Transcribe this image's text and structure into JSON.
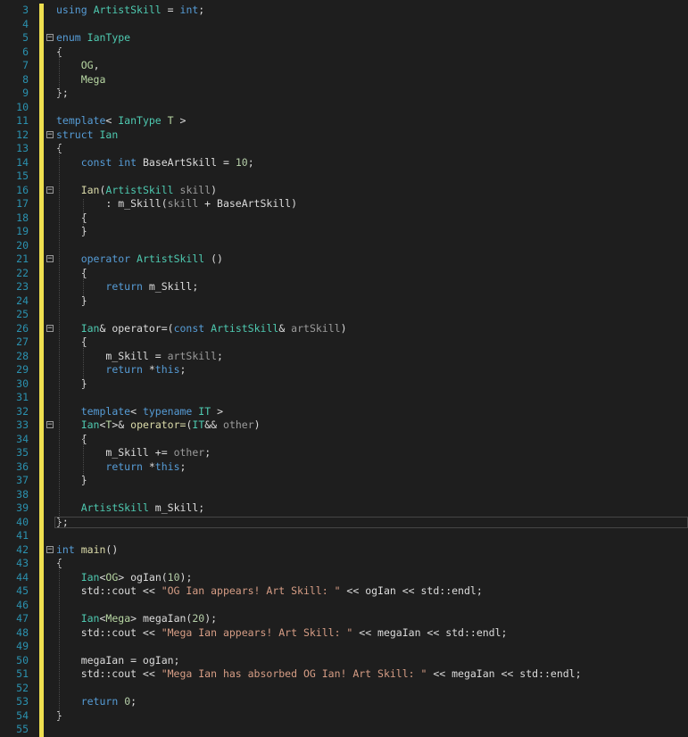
{
  "editor": {
    "colors": {
      "background": "#1e1e1e",
      "line_number": "#2b91af",
      "change_marker": "#eedf4f",
      "keyword": "#569cd6",
      "type": "#4ec9b0",
      "function": "#dcdcaa",
      "string": "#d69d85",
      "number": "#b5cea8",
      "parameter": "#9b9b9b"
    },
    "lines": [
      {
        "n": "3",
        "fold": false,
        "tokens": [
          {
            "t": "using",
            "c": "kw"
          },
          {
            "t": " ",
            "c": "pl"
          },
          {
            "t": "ArtistSkill",
            "c": "ty"
          },
          {
            "t": " = ",
            "c": "pl"
          },
          {
            "t": "int",
            "c": "kw"
          },
          {
            "t": ";",
            "c": "pl"
          }
        ]
      },
      {
        "n": "4",
        "fold": false,
        "tokens": []
      },
      {
        "n": "5",
        "fold": true,
        "tokens": [
          {
            "t": "enum",
            "c": "kw"
          },
          {
            "t": " ",
            "c": "pl"
          },
          {
            "t": "IanType",
            "c": "ty"
          }
        ]
      },
      {
        "n": "6",
        "fold": false,
        "tokens": [
          {
            "t": "{",
            "c": "pl"
          }
        ]
      },
      {
        "n": "7",
        "fold": false,
        "tokens": [
          {
            "t": "    ",
            "c": "pl"
          },
          {
            "t": "OG",
            "c": "en"
          },
          {
            "t": ",",
            "c": "pl"
          }
        ]
      },
      {
        "n": "8",
        "fold": false,
        "tokens": [
          {
            "t": "    ",
            "c": "pl"
          },
          {
            "t": "Mega",
            "c": "en"
          }
        ]
      },
      {
        "n": "9",
        "fold": false,
        "tokens": [
          {
            "t": "};",
            "c": "pl"
          }
        ]
      },
      {
        "n": "10",
        "fold": false,
        "tokens": []
      },
      {
        "n": "11",
        "fold": false,
        "tokens": [
          {
            "t": "template",
            "c": "kw"
          },
          {
            "t": "< ",
            "c": "pl"
          },
          {
            "t": "IanType",
            "c": "ty"
          },
          {
            "t": " ",
            "c": "pl"
          },
          {
            "t": "T",
            "c": "tp"
          },
          {
            "t": " >",
            "c": "pl"
          }
        ]
      },
      {
        "n": "12",
        "fold": true,
        "tokens": [
          {
            "t": "struct",
            "c": "kw"
          },
          {
            "t": " ",
            "c": "pl"
          },
          {
            "t": "Ian",
            "c": "ty"
          }
        ]
      },
      {
        "n": "13",
        "fold": false,
        "tokens": [
          {
            "t": "{",
            "c": "pl"
          }
        ]
      },
      {
        "n": "14",
        "fold": false,
        "tokens": [
          {
            "t": "    ",
            "c": "pl"
          },
          {
            "t": "const",
            "c": "kw"
          },
          {
            "t": " ",
            "c": "pl"
          },
          {
            "t": "int",
            "c": "kw"
          },
          {
            "t": " BaseArtSkill = ",
            "c": "pl"
          },
          {
            "t": "10",
            "c": "nu"
          },
          {
            "t": ";",
            "c": "pl"
          }
        ]
      },
      {
        "n": "15",
        "fold": false,
        "tokens": []
      },
      {
        "n": "16",
        "fold": true,
        "tokens": [
          {
            "t": "    ",
            "c": "pl"
          },
          {
            "t": "Ian",
            "c": "fn"
          },
          {
            "t": "(",
            "c": "pl"
          },
          {
            "t": "ArtistSkill",
            "c": "ty"
          },
          {
            "t": " ",
            "c": "pl"
          },
          {
            "t": "skill",
            "c": "pa"
          },
          {
            "t": ")",
            "c": "pl"
          }
        ]
      },
      {
        "n": "17",
        "fold": false,
        "tokens": [
          {
            "t": "        : m_Skill(",
            "c": "pl"
          },
          {
            "t": "skill",
            "c": "pa"
          },
          {
            "t": " + BaseArtSkill)",
            "c": "pl"
          }
        ]
      },
      {
        "n": "18",
        "fold": false,
        "tokens": [
          {
            "t": "    {",
            "c": "pl"
          }
        ]
      },
      {
        "n": "19",
        "fold": false,
        "tokens": [
          {
            "t": "    }",
            "c": "pl"
          }
        ]
      },
      {
        "n": "20",
        "fold": false,
        "tokens": []
      },
      {
        "n": "21",
        "fold": true,
        "tokens": [
          {
            "t": "    ",
            "c": "pl"
          },
          {
            "t": "operator",
            "c": "kw"
          },
          {
            "t": " ",
            "c": "pl"
          },
          {
            "t": "ArtistSkill",
            "c": "ty"
          },
          {
            "t": " ()",
            "c": "pl"
          }
        ]
      },
      {
        "n": "22",
        "fold": false,
        "tokens": [
          {
            "t": "    {",
            "c": "pl"
          }
        ]
      },
      {
        "n": "23",
        "fold": false,
        "tokens": [
          {
            "t": "        ",
            "c": "pl"
          },
          {
            "t": "return",
            "c": "kw"
          },
          {
            "t": " m_Skill;",
            "c": "pl"
          }
        ]
      },
      {
        "n": "24",
        "fold": false,
        "tokens": [
          {
            "t": "    }",
            "c": "pl"
          }
        ]
      },
      {
        "n": "25",
        "fold": false,
        "tokens": []
      },
      {
        "n": "26",
        "fold": true,
        "tokens": [
          {
            "t": "    ",
            "c": "pl"
          },
          {
            "t": "Ian",
            "c": "ty"
          },
          {
            "t": "& operator=(",
            "c": "pl"
          },
          {
            "t": "const",
            "c": "kw"
          },
          {
            "t": " ",
            "c": "pl"
          },
          {
            "t": "ArtistSkill",
            "c": "ty"
          },
          {
            "t": "& ",
            "c": "pl"
          },
          {
            "t": "artSkill",
            "c": "pa"
          },
          {
            "t": ")",
            "c": "pl"
          }
        ]
      },
      {
        "n": "27",
        "fold": false,
        "tokens": [
          {
            "t": "    {",
            "c": "pl"
          }
        ]
      },
      {
        "n": "28",
        "fold": false,
        "tokens": [
          {
            "t": "        m_Skill = ",
            "c": "pl"
          },
          {
            "t": "artSkill",
            "c": "pa"
          },
          {
            "t": ";",
            "c": "pl"
          }
        ]
      },
      {
        "n": "29",
        "fold": false,
        "tokens": [
          {
            "t": "        ",
            "c": "pl"
          },
          {
            "t": "return",
            "c": "kw"
          },
          {
            "t": " *",
            "c": "pl"
          },
          {
            "t": "this",
            "c": "kw"
          },
          {
            "t": ";",
            "c": "pl"
          }
        ]
      },
      {
        "n": "30",
        "fold": false,
        "tokens": [
          {
            "t": "    }",
            "c": "pl"
          }
        ]
      },
      {
        "n": "31",
        "fold": false,
        "tokens": []
      },
      {
        "n": "32",
        "fold": false,
        "tokens": [
          {
            "t": "    ",
            "c": "pl"
          },
          {
            "t": "template",
            "c": "kw"
          },
          {
            "t": "< ",
            "c": "pl"
          },
          {
            "t": "typename",
            "c": "kw"
          },
          {
            "t": " ",
            "c": "pl"
          },
          {
            "t": "IT",
            "c": "ty"
          },
          {
            "t": " >",
            "c": "pl"
          }
        ]
      },
      {
        "n": "33",
        "fold": true,
        "tokens": [
          {
            "t": "    ",
            "c": "pl"
          },
          {
            "t": "Ian",
            "c": "ty"
          },
          {
            "t": "<",
            "c": "pl"
          },
          {
            "t": "T",
            "c": "tp"
          },
          {
            "t": ">& ",
            "c": "pl"
          },
          {
            "t": "operator=",
            "c": "fn"
          },
          {
            "t": "(",
            "c": "pl"
          },
          {
            "t": "IT",
            "c": "ty"
          },
          {
            "t": "&& ",
            "c": "pl"
          },
          {
            "t": "other",
            "c": "pa"
          },
          {
            "t": ")",
            "c": "pl"
          }
        ]
      },
      {
        "n": "34",
        "fold": false,
        "tokens": [
          {
            "t": "    {",
            "c": "pl"
          }
        ]
      },
      {
        "n": "35",
        "fold": false,
        "tokens": [
          {
            "t": "        m_Skill += ",
            "c": "pl"
          },
          {
            "t": "other",
            "c": "pa"
          },
          {
            "t": ";",
            "c": "pl"
          }
        ]
      },
      {
        "n": "36",
        "fold": false,
        "tokens": [
          {
            "t": "        ",
            "c": "pl"
          },
          {
            "t": "return",
            "c": "kw"
          },
          {
            "t": " *",
            "c": "pl"
          },
          {
            "t": "this",
            "c": "kw"
          },
          {
            "t": ";",
            "c": "pl"
          }
        ]
      },
      {
        "n": "37",
        "fold": false,
        "tokens": [
          {
            "t": "    }",
            "c": "pl"
          }
        ]
      },
      {
        "n": "38",
        "fold": false,
        "tokens": []
      },
      {
        "n": "39",
        "fold": false,
        "tokens": [
          {
            "t": "    ",
            "c": "pl"
          },
          {
            "t": "ArtistSkill",
            "c": "ty"
          },
          {
            "t": " m_Skill;",
            "c": "pl"
          }
        ]
      },
      {
        "n": "40",
        "fold": false,
        "current": true,
        "tokens": [
          {
            "t": "};",
            "c": "pl"
          }
        ]
      },
      {
        "n": "41",
        "fold": false,
        "tokens": []
      },
      {
        "n": "42",
        "fold": true,
        "tokens": [
          {
            "t": "int",
            "c": "kw"
          },
          {
            "t": " ",
            "c": "pl"
          },
          {
            "t": "main",
            "c": "fn"
          },
          {
            "t": "()",
            "c": "pl"
          }
        ]
      },
      {
        "n": "43",
        "fold": false,
        "tokens": [
          {
            "t": "{",
            "c": "pl"
          }
        ]
      },
      {
        "n": "44",
        "fold": false,
        "tokens": [
          {
            "t": "    ",
            "c": "pl"
          },
          {
            "t": "Ian",
            "c": "ty"
          },
          {
            "t": "<",
            "c": "pl"
          },
          {
            "t": "OG",
            "c": "en"
          },
          {
            "t": "> ogIan(",
            "c": "pl"
          },
          {
            "t": "10",
            "c": "nu"
          },
          {
            "t": ");",
            "c": "pl"
          }
        ]
      },
      {
        "n": "45",
        "fold": false,
        "tokens": [
          {
            "t": "    std::cout << ",
            "c": "pl"
          },
          {
            "t": "\"OG Ian appears! Art Skill: \"",
            "c": "st"
          },
          {
            "t": " << ogIan << std::endl;",
            "c": "pl"
          }
        ]
      },
      {
        "n": "46",
        "fold": false,
        "tokens": []
      },
      {
        "n": "47",
        "fold": false,
        "tokens": [
          {
            "t": "    ",
            "c": "pl"
          },
          {
            "t": "Ian",
            "c": "ty"
          },
          {
            "t": "<",
            "c": "pl"
          },
          {
            "t": "Mega",
            "c": "en"
          },
          {
            "t": "> megaIan(",
            "c": "pl"
          },
          {
            "t": "20",
            "c": "nu"
          },
          {
            "t": ");",
            "c": "pl"
          }
        ]
      },
      {
        "n": "48",
        "fold": false,
        "tokens": [
          {
            "t": "    std::cout << ",
            "c": "pl"
          },
          {
            "t": "\"Mega Ian appears! Art Skill: \"",
            "c": "st"
          },
          {
            "t": " << megaIan << std::endl;",
            "c": "pl"
          }
        ]
      },
      {
        "n": "49",
        "fold": false,
        "tokens": []
      },
      {
        "n": "50",
        "fold": false,
        "tokens": [
          {
            "t": "    megaIan = ogIan;",
            "c": "pl"
          }
        ]
      },
      {
        "n": "51",
        "fold": false,
        "tokens": [
          {
            "t": "    std::cout << ",
            "c": "pl"
          },
          {
            "t": "\"Mega Ian has absorbed OG Ian! Art Skill: \"",
            "c": "st"
          },
          {
            "t": " << megaIan << std::endl;",
            "c": "pl"
          }
        ]
      },
      {
        "n": "52",
        "fold": false,
        "tokens": []
      },
      {
        "n": "53",
        "fold": false,
        "tokens": [
          {
            "t": "    ",
            "c": "pl"
          },
          {
            "t": "return",
            "c": "kw"
          },
          {
            "t": " ",
            "c": "pl"
          },
          {
            "t": "0",
            "c": "nu"
          },
          {
            "t": ";",
            "c": "pl"
          }
        ]
      },
      {
        "n": "54",
        "fold": false,
        "tokens": [
          {
            "t": "}",
            "c": "pl"
          }
        ]
      },
      {
        "n": "55",
        "fold": false,
        "tokens": []
      }
    ]
  }
}
